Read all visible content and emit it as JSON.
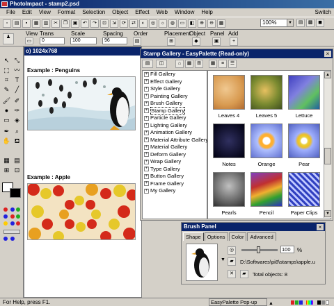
{
  "window": {
    "title": "PhotoImpact - stamp2.psd"
  },
  "menu": {
    "items": [
      "File",
      "Edit",
      "View",
      "Format",
      "Selection",
      "Object",
      "Effect",
      "Web",
      "Window",
      "Help"
    ],
    "switch_label": "Switch"
  },
  "toolbar": {
    "zoom_value": "100%"
  },
  "attributes": {
    "view_label": "View",
    "trans_label": "Trans",
    "trans_value": "0",
    "scale_label": "Scale",
    "scale_value": "100",
    "spacing_label": "Spacing",
    "spacing_value": "96",
    "order_label": "Order",
    "placement_label": "Placement",
    "object_label": "Object",
    "panel_label": "Panel",
    "add_label": "Add"
  },
  "document": {
    "title": "o) 1024x768",
    "example1": "Example : Penguins",
    "example2": "Example : Apple"
  },
  "gallery": {
    "title": "Stamp Gallery - EasyPalette (Read-only)",
    "tree": [
      "Fill Gallery",
      "Effect Gallery",
      "Style Gallery",
      "Painting Gallery",
      "Brush Gallery",
      "Stamp Gallery",
      "Particle Gallery",
      "Lighting Gallery",
      "Animation Gallery",
      "Material Attribute Gallery",
      "Material Gallery",
      "Deform Gallery",
      "Wrap Gallery",
      "Type Gallery",
      "Button Gallery",
      "Frame Gallery",
      "My Gallery"
    ],
    "selected_index": 5,
    "thumbs": [
      "Leaves 4",
      "Leaves 5",
      "Lettuce",
      "Notes",
      "Orange",
      "Pear",
      "Pearls",
      "Pencil",
      "Paper Clips"
    ]
  },
  "brush_panel": {
    "title": "Brush Panel",
    "tabs": [
      "Shape",
      "Options",
      "Color",
      "Advanced"
    ],
    "active_tab": "Shape",
    "size_value": "100",
    "size_unit": "%",
    "path": "D:\\Softwares\\pi8\\stamps\\apple.u",
    "total_objects": "Total objects: 8"
  },
  "status": {
    "help_text": "For Help, press F1.",
    "popup_label": "EasyPalette Pop-up"
  },
  "colors": {
    "title_bar": "#0a246a",
    "chrome": "#d4d0c8",
    "selection_orange": "#f5a623"
  }
}
